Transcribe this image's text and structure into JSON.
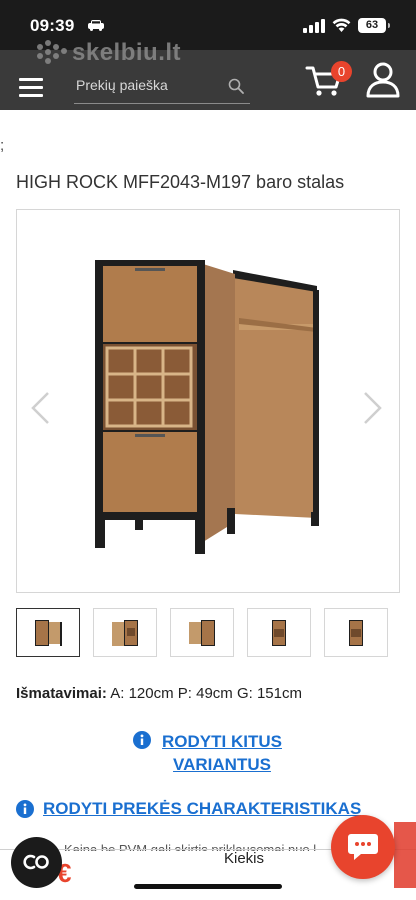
{
  "status_bar": {
    "time": "09:39",
    "battery": "63"
  },
  "header": {
    "logo_text": "skelbiu.lt",
    "search_placeholder": "Prekių paieška",
    "cart_count": "0"
  },
  "content": {
    "stray_char": ";",
    "title": "HIGH ROCK MFF2043-M197 baro stalas",
    "dimensions_label": "Išmatavimai:",
    "dimensions_value": " A: 120cm P: 49cm G: 151cm",
    "variants_link": "RODYTI KITUS VARIANTUS",
    "specs_link": "RODYTI PREKĖS CHARAKTERISTIKAS",
    "thumbnails_count": 5
  },
  "bottom": {
    "partial_text": "Kaina be PVM gali skirtis priklausomai nuo l",
    "quantity_label": "Kiekis",
    "price_currency": "€"
  },
  "colors": {
    "header_bg": "#3a3a3a",
    "accent_red": "#e8442d",
    "link_blue": "#1a6fd0"
  }
}
